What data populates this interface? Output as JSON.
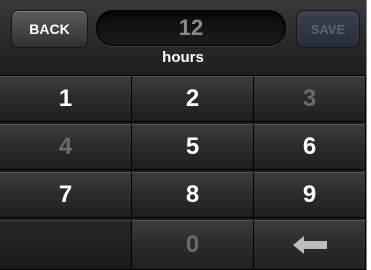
{
  "header": {
    "back_label": "BACK",
    "value": "12",
    "save_label": "SAVE",
    "unit_label": "hours"
  },
  "keypad": {
    "keys": [
      {
        "label": "1",
        "enabled": true
      },
      {
        "label": "2",
        "enabled": true
      },
      {
        "label": "3",
        "enabled": false
      },
      {
        "label": "4",
        "enabled": false
      },
      {
        "label": "5",
        "enabled": true
      },
      {
        "label": "6",
        "enabled": true
      },
      {
        "label": "7",
        "enabled": true
      },
      {
        "label": "8",
        "enabled": true
      },
      {
        "label": "9",
        "enabled": true
      },
      {
        "label": "",
        "enabled": false
      },
      {
        "label": "0",
        "enabled": false
      },
      {
        "label": "",
        "icon": "backspace-arrow-icon",
        "enabled": true
      }
    ]
  },
  "colors": {
    "background": "#1c1c1c",
    "key_text": "#ffffff",
    "key_disabled_text": "#6a6a6a",
    "save_disabled": "#5a6270"
  }
}
